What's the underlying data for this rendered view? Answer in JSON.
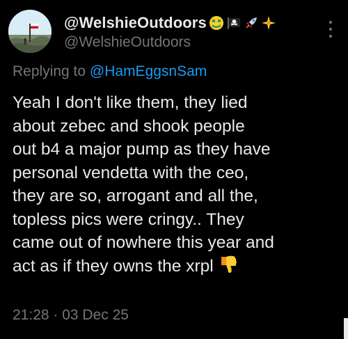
{
  "tweet": {
    "display_name": "@WelshieOutdoors",
    "handle": "@WelshieOutdoors",
    "name_emojis": [
      "money-mouth-face-icon",
      "pirate-flag-icon",
      "rocket-icon",
      "sparkle-icon"
    ],
    "replying_prefix": "Replying to",
    "replying_to": "@HamEggsnSam",
    "body_lines": [
      "Yeah I don't like them, they lied",
      "about zebec and shook people",
      "out b4 a major pump as they have",
      "personal vendetta with the ceo,",
      "they are so, arrogant and all the,",
      "topless pics were cringy.. They",
      "came out of nowhere this year and",
      "act as if they owns the xrpl"
    ],
    "body_end_emoji": "thumbs-down-icon",
    "timestamp": "21:28 · 03 Dec 25"
  },
  "colors": {
    "background": "#000000",
    "primary_text": "#e7e9ea",
    "secondary_text": "#71767b",
    "link": "#1d9bf0"
  }
}
